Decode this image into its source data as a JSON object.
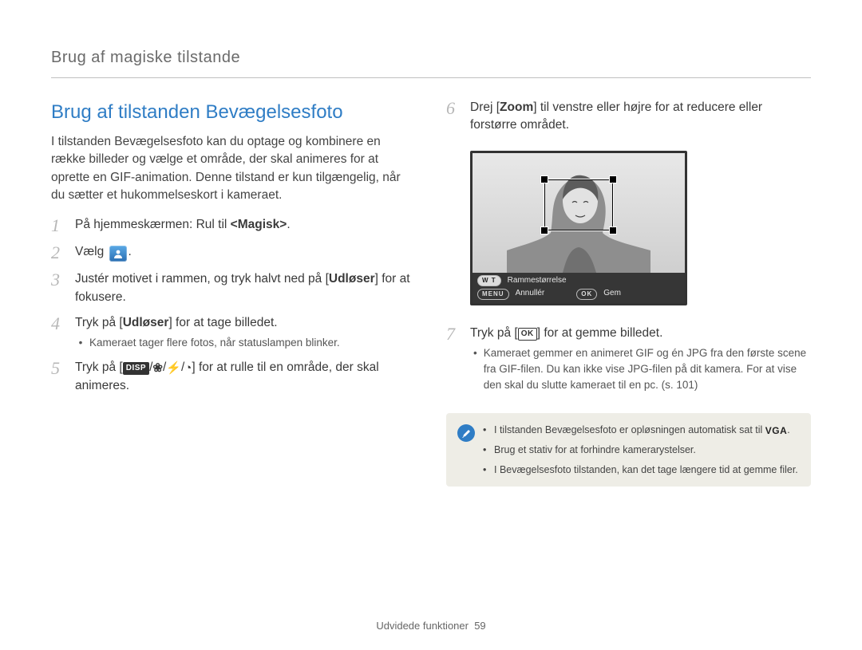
{
  "header": "Brug af magiske tilstande",
  "title": "Brug af tilstanden Bevægelsesfoto",
  "intro": "I tilstanden Bevægelsesfoto kan du optage og kombinere en række billeder og vælge et område, der skal animeres for at oprette en GIF-animation. Denne tilstand er kun tilgængelig, når du sætter et hukommelseskort i kameraet.",
  "steps": {
    "s1": {
      "num": "1",
      "pre": "På hjemmeskærmen: Rul til ",
      "bold": "<Magisk>",
      "post": "."
    },
    "s2": {
      "num": "2",
      "pre": "Vælg ",
      "post": "."
    },
    "s3": {
      "num": "3",
      "pre": "Justér motivet i rammen, og tryk halvt ned på [",
      "bold": "Udløser",
      "post": "] for at fokusere."
    },
    "s4": {
      "num": "4",
      "pre": "Tryk på [",
      "bold": "Udløser",
      "post": "] for at tage billedet.",
      "bullet": "Kameraet tager flere fotos, når statuslampen blinker."
    },
    "s5": {
      "num": "5",
      "pre": "Tryk på [",
      "icons": [
        "DISP",
        "flower",
        "bolt",
        "timer"
      ],
      "post": "] for at rulle til en område, der skal animeres."
    },
    "s6": {
      "num": "6",
      "pre": "Drej [",
      "bold": "Zoom",
      "post": "] til venstre eller højre for at reducere eller forstørre området."
    },
    "s7": {
      "num": "7",
      "pre": "Tryk på [",
      "ok": "OK",
      "post": "] for at gemme billedet.",
      "bullet": "Kameraet gemmer en animeret GIF og én JPG fra den første scene fra GIF-filen. Du kan ikke vise JPG-filen på dit kamera. For at vise den skal du slutte kameraet til en pc. (s. 101)"
    }
  },
  "preview": {
    "frame_size_label": "Rammestørrelse",
    "wt_label": "W T",
    "menu_label": "MENU",
    "cancel_label": "Annullér",
    "ok_label": "OK",
    "save_label": "Gem"
  },
  "note": {
    "items": [
      {
        "pre": "I tilstanden Bevægelsesfoto er opløsningen automatisk sat til ",
        "vga": "VGA",
        "post": "."
      },
      {
        "pre": "Brug et stativ for at forhindre kamerarystelser.",
        "post": ""
      },
      {
        "pre": "I Bevægelsesfoto tilstanden, kan det tage længere tid at gemme filer.",
        "post": ""
      }
    ]
  },
  "footer": {
    "section": "Udvidede funktioner",
    "page": "59"
  }
}
